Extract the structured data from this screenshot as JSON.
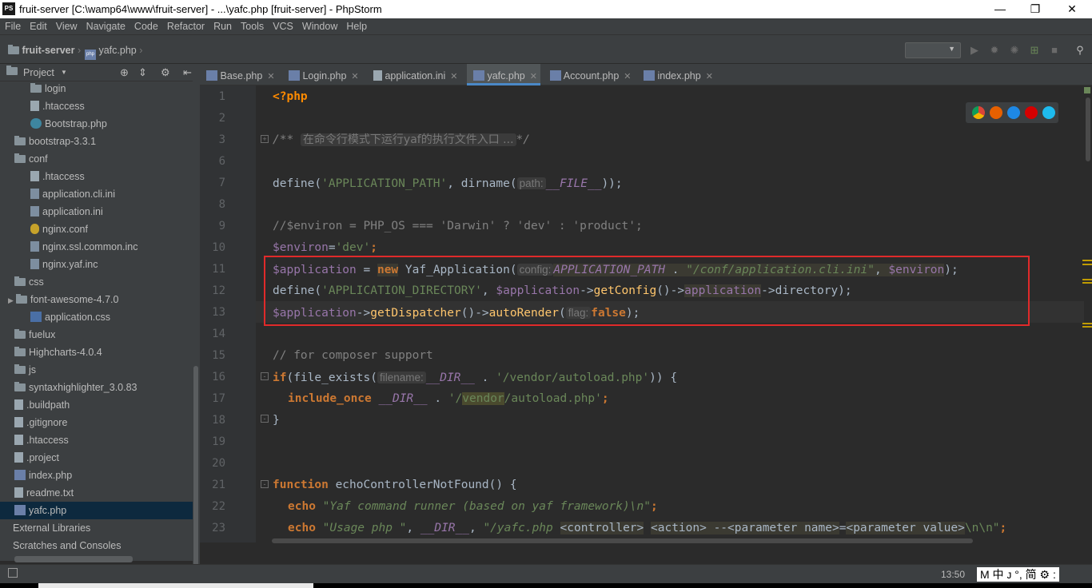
{
  "window": {
    "title": "fruit-server [C:\\wamp64\\www\\fruit-server] - ...\\yafc.php [fruit-server] - PhpStorm",
    "app_icon": "PS",
    "minimize": "—",
    "restore": "❐",
    "close": "✕"
  },
  "menu": [
    "File",
    "Edit",
    "View",
    "Navigate",
    "Code",
    "Refactor",
    "Run",
    "Tools",
    "VCS",
    "Window",
    "Help"
  ],
  "breadcrumb": {
    "project": "fruit-server",
    "file": "yafc.php"
  },
  "project_panel": {
    "title": "Project",
    "tree": [
      {
        "label": "login",
        "kind": "folder",
        "indent": 2
      },
      {
        "label": ".htaccess",
        "kind": "file",
        "indent": 2
      },
      {
        "label": "Bootstrap.php",
        "kind": "class",
        "indent": 2
      },
      {
        "label": "bootstrap-3.3.1",
        "kind": "folder",
        "indent": 1,
        "arrow": "▶"
      },
      {
        "label": "conf",
        "kind": "folder",
        "indent": 1,
        "arrow": "▼"
      },
      {
        "label": ".htaccess",
        "kind": "file",
        "indent": 2
      },
      {
        "label": "application.cli.ini",
        "kind": "ini",
        "indent": 2
      },
      {
        "label": "application.ini",
        "kind": "ini",
        "indent": 2
      },
      {
        "label": "nginx.conf",
        "kind": "conf",
        "indent": 2
      },
      {
        "label": "nginx.ssl.common.inc",
        "kind": "ini",
        "indent": 2
      },
      {
        "label": "nginx.yaf.inc",
        "kind": "ini",
        "indent": 2
      },
      {
        "label": "css",
        "kind": "folder",
        "indent": 1,
        "arrow": "▼"
      },
      {
        "label": "font-awesome-4.7.0",
        "kind": "folder",
        "indent": 2,
        "arrow": "▶"
      },
      {
        "label": "application.css",
        "kind": "css",
        "indent": 2
      },
      {
        "label": "fuelux",
        "kind": "folder",
        "indent": 1,
        "arrow": "▶"
      },
      {
        "label": "Highcharts-4.0.4",
        "kind": "folder",
        "indent": 1,
        "arrow": "▶"
      },
      {
        "label": "js",
        "kind": "folder",
        "indent": 1,
        "arrow": "▶"
      },
      {
        "label": "syntaxhighlighter_3.0.83",
        "kind": "folder",
        "indent": 1,
        "arrow": "▶"
      },
      {
        "label": ".buildpath",
        "kind": "file",
        "indent": 1
      },
      {
        "label": ".gitignore",
        "kind": "file",
        "indent": 1
      },
      {
        "label": ".htaccess",
        "kind": "file",
        "indent": 1
      },
      {
        "label": ".project",
        "kind": "file",
        "indent": 1
      },
      {
        "label": "index.php",
        "kind": "php",
        "indent": 1
      },
      {
        "label": "readme.txt",
        "kind": "file",
        "indent": 1
      },
      {
        "label": "yafc.php",
        "kind": "php",
        "indent": 1,
        "selected": true
      },
      {
        "label": "External Libraries",
        "kind": "lib",
        "indent": 0
      },
      {
        "label": "Scratches and Consoles",
        "kind": "scratch",
        "indent": 0
      }
    ]
  },
  "tabs": [
    {
      "label": "Base.php",
      "icon": "php"
    },
    {
      "label": "Login.php",
      "icon": "php"
    },
    {
      "label": "application.ini",
      "icon": "ini"
    },
    {
      "label": "yafc.php",
      "icon": "php",
      "active": true
    },
    {
      "label": "Account.php",
      "icon": "php"
    },
    {
      "label": "index.php",
      "icon": "php"
    }
  ],
  "line_numbers": [
    "1",
    "2",
    "3",
    "6",
    "7",
    "8",
    "9",
    "10",
    "11",
    "12",
    "13",
    "14",
    "15",
    "16",
    "17",
    "18",
    "19",
    "20",
    "21",
    "22",
    "23"
  ],
  "code": {
    "l1": "<?php",
    "l3_a": "/** ",
    "l3_b": "在命令行模式下运行yaf的执行文件入口 ...",
    "l3_c": "*/",
    "l6_a": "define(",
    "l6_b": "'APPLICATION_PATH'",
    "l6_c": ", dirname(",
    "l6_hint": "path:",
    "l6_d": "__FILE__",
    "l6_e": "));",
    "l8": "//$environ = PHP_OS === 'Darwin' ? 'dev' : 'product';",
    "l9_a": "$environ",
    "l9_b": "=",
    "l9_c": "'dev'",
    "l9_d": ";",
    "l10_a": "$application",
    "l10_b": " = ",
    "l10_c": "new",
    "l10_d": " Yaf_Application(",
    "l10_hint": "config:",
    "l10_e": "APPLICATION_PATH",
    "l10_f": " . ",
    "l10_g": "\"/conf/application.cli.ini\"",
    "l10_h": ", ",
    "l10_i": "$environ",
    "l10_j": ");",
    "l11_a": "define(",
    "l11_b": "'APPLICATION_DIRECTORY'",
    "l11_c": ", ",
    "l11_d": "$application",
    "l11_e": "->",
    "l11_f": "getConfig",
    "l11_g": "()->",
    "l11_h": "application",
    "l11_i": "->directory);",
    "l12_a": "$application",
    "l12_b": "->",
    "l12_c": "getDispatcher",
    "l12_d": "()->",
    "l12_e": "autoRender",
    "l12_f": "(",
    "l12_hint": "flag:",
    "l12_g": "false",
    "l12_h": ");",
    "l14": "// for composer support",
    "l15_a": "if",
    "l15_b": "(file_exists(",
    "l15_hint": "filename:",
    "l15_c": "__DIR__",
    "l15_d": " . ",
    "l15_e": "'/vendor/autoload.php'",
    "l15_f": ")) {",
    "l16_a": "include_once",
    "l16_b": " ",
    "l16_c": "__DIR__",
    "l16_d": " . ",
    "l16_e": "'/",
    "l16_f": "vendor",
    "l16_g": "/autoload.php'",
    "l16_h": ";",
    "l17": "}",
    "l20_a": "function",
    "l20_b": " echoControllerNotFound() {",
    "l21_a": "echo",
    "l21_b": " \"Yaf command runner (based on yaf framework)\\n\"",
    "l21_c": ";",
    "l22_a": "echo",
    "l22_b": " \"Usage php \"",
    "l22_c": ", ",
    "l22_d": "__DIR__",
    "l22_e": ", ",
    "l22_f": "\"/yafc.php ",
    "l22_g": "<controller>",
    "l22_h": " ",
    "l22_i": "<action>",
    "l22_j": " --",
    "l22_k": "<parameter name>",
    "l22_l": "=",
    "l22_m": "<parameter value>",
    "l22_n": "\\n\\n\"",
    "l22_o": ";"
  },
  "status": {
    "time": "13:50",
    "ime": "M 中 ᴊ °, 简 ⚙ :"
  },
  "colors": {
    "bg": "#2b2b2b",
    "panel": "#3c3f41",
    "keyword": "#cc7832",
    "string": "#6a8759",
    "variable": "#9876aa",
    "highlight_box": "#e02a2a"
  }
}
